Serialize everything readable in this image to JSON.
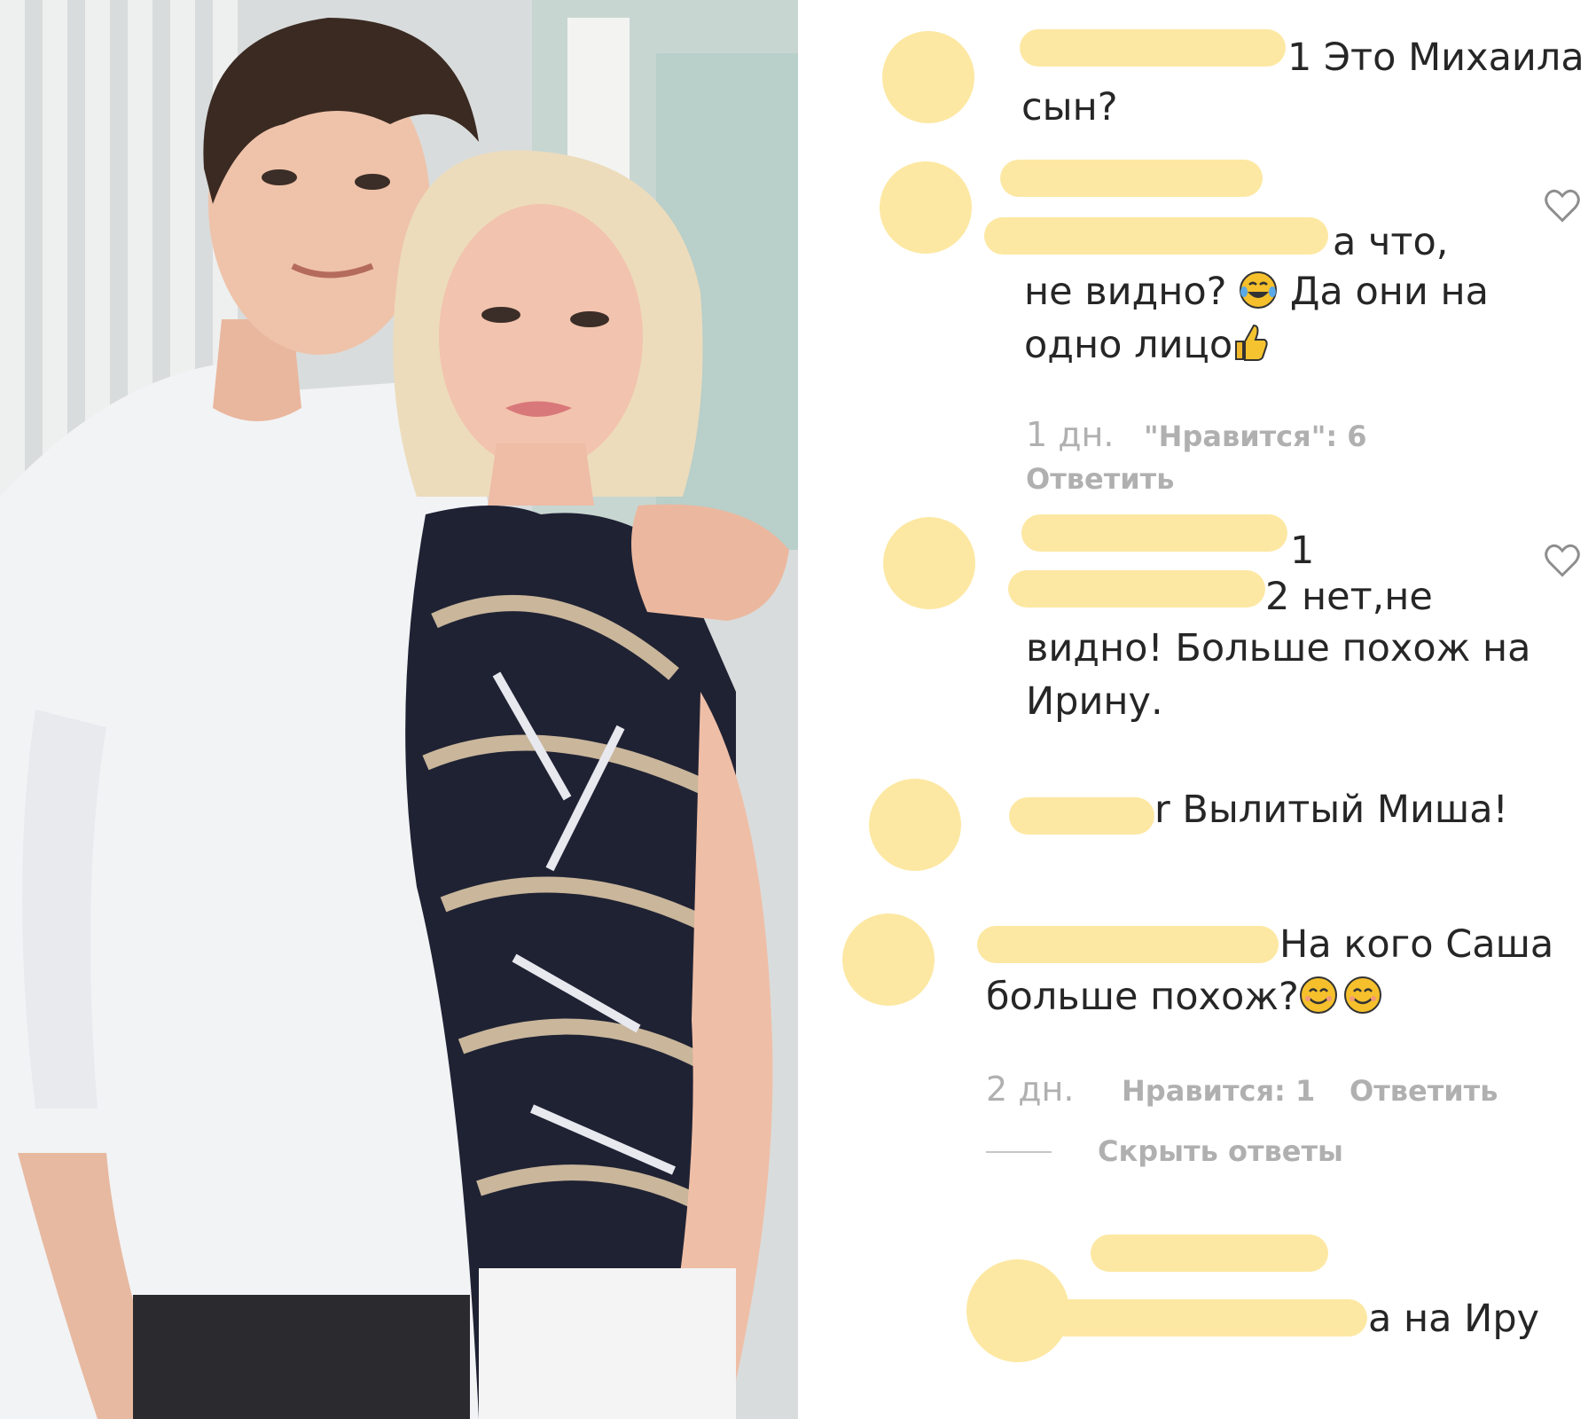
{
  "colors": {
    "redaction": "#fde8a3",
    "text": "#262626",
    "meta": "#b0b0b0",
    "background": "#ffffff"
  },
  "photo": {
    "description_icon": "photo-of-young-man-and-blonde-woman"
  },
  "comments": [
    {
      "line1": "1 Это Михаила",
      "line2": "сын?"
    },
    {
      "line1": "а что,",
      "line2a": "не видно? ",
      "line2b": " Да они на",
      "line3": "одно лицо",
      "emoji1": "tears-of-joy-icon",
      "emoji2": "thumbs-up-icon",
      "time": "1 дн.",
      "likes": "\"Нравится\": 6",
      "reply": "Ответить"
    },
    {
      "username_tail": "1",
      "line1": "2 нет,не",
      "line2": "видно! Больше похож на",
      "line3": "Ирину."
    },
    {
      "line1": "r Вылитый Миша!"
    },
    {
      "line1": "На кого Саша",
      "line2": "больше похож?",
      "emoji": "smiling-face-icon",
      "time": "2 дн.",
      "likes": "Нравится: 1",
      "reply": "Ответить",
      "hide_replies": "Скрыть ответы"
    },
    {
      "line1": "а на Иру"
    }
  ]
}
